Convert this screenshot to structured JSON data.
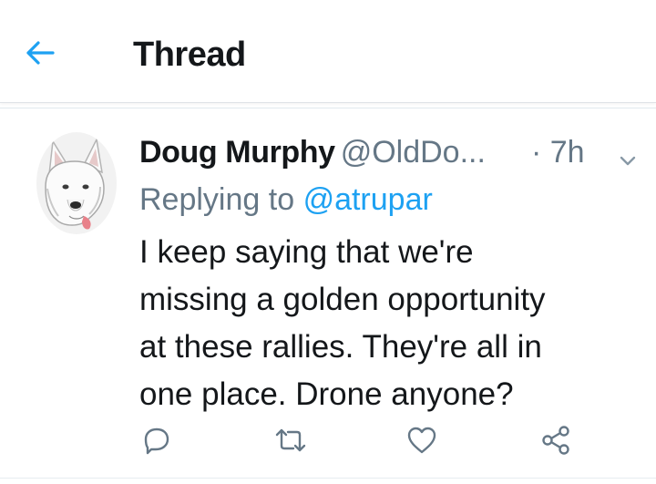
{
  "header": {
    "title": "Thread",
    "back_icon": "arrow-left-icon"
  },
  "tweet": {
    "display_name": "Doug Murphy",
    "handle": "@OldDo...",
    "timestamp": "· 7h",
    "reply_prefix": "Replying to",
    "reply_to": "@atrupar",
    "text_lines": [
      "I keep saying that we're",
      "missing a golden opportunity",
      "at these rallies. They're all in",
      "one place. Drone anyone?"
    ],
    "actions": [
      "reply-icon",
      "retweet-icon",
      "like-icon",
      "share-icon"
    ]
  },
  "colors": {
    "accent": "#1da1f2",
    "secondary_text": "#657786",
    "primary_text": "#14171a"
  }
}
